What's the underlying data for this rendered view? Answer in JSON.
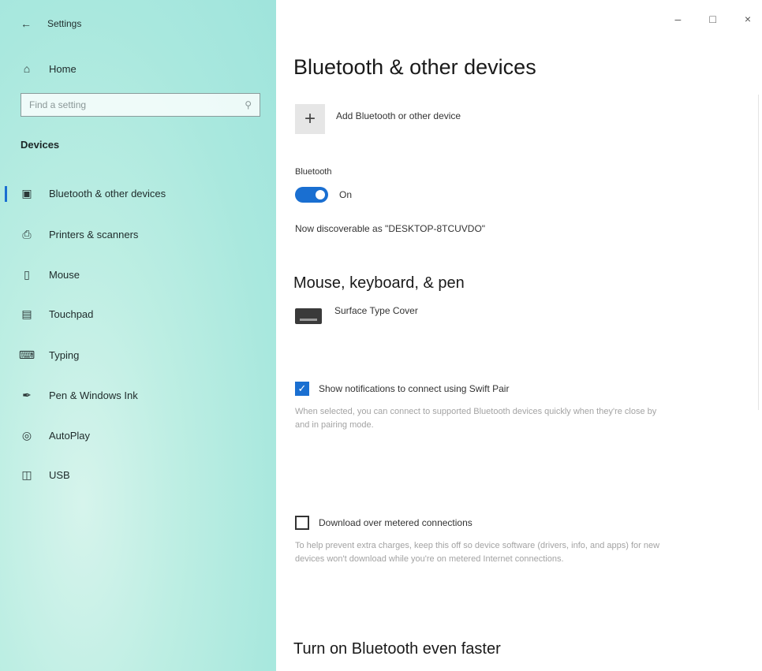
{
  "window": {
    "title": "Settings"
  },
  "sidebar": {
    "home_label": "Home",
    "search_placeholder": "Find a setting",
    "section_title": "Devices",
    "items": [
      {
        "label": "Bluetooth & other devices",
        "icon": "bluetooth-devices-icon",
        "selected": true
      },
      {
        "label": "Printers & scanners",
        "icon": "printer-icon",
        "selected": false
      },
      {
        "label": "Mouse",
        "icon": "mouse-icon",
        "selected": false
      },
      {
        "label": "Touchpad",
        "icon": "touchpad-icon",
        "selected": false
      },
      {
        "label": "Typing",
        "icon": "keyboard-icon",
        "selected": false
      },
      {
        "label": "Pen & Windows Ink",
        "icon": "pen-icon",
        "selected": false
      },
      {
        "label": "AutoPlay",
        "icon": "autoplay-icon",
        "selected": false
      },
      {
        "label": "USB",
        "icon": "usb-icon",
        "selected": false
      }
    ]
  },
  "main": {
    "title": "Bluetooth & other devices",
    "add_device_label": "Add Bluetooth or other device",
    "bluetooth_label": "Bluetooth",
    "bluetooth_state": "On",
    "bluetooth_on": true,
    "discoverable_text": "Now discoverable as \"DESKTOP-8TCUVDO\"",
    "mkp_title": "Mouse, keyboard, & pen",
    "device_name": "Surface Type Cover",
    "swift_pair": {
      "label": "Show notifications to connect using Swift Pair",
      "checked": true,
      "description": "When selected, you can connect to supported Bluetooth devices quickly when they're close by and in pairing mode."
    },
    "metered": {
      "label": "Download over metered connections",
      "checked": false,
      "description": "To help prevent extra charges, keep this off so device software (drivers, info, and apps) for new devices won't download while you're on metered Internet connections."
    },
    "bottom_title": "Turn on Bluetooth even faster"
  },
  "colors": {
    "accent": "#1a6fd1",
    "sidebar": "#a9e8de"
  }
}
